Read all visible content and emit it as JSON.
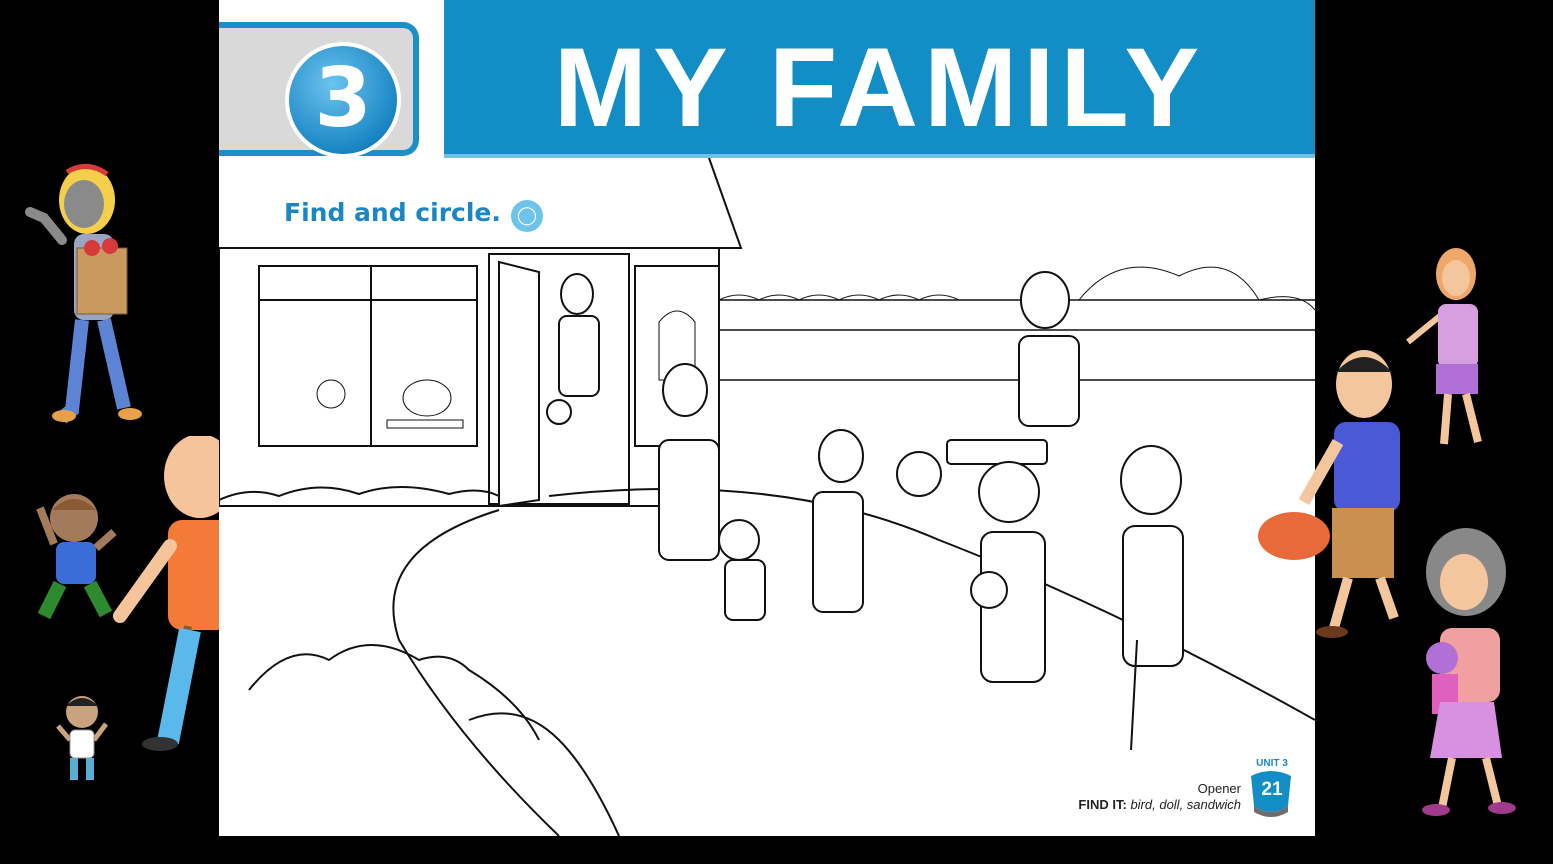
{
  "header": {
    "unit_number": "3",
    "title": "MY FAMILY"
  },
  "instruction": {
    "text": "Find and circle.",
    "icon": "speech-bubble-icon"
  },
  "footer": {
    "opener_label": "Opener",
    "find_it_label": "FIND IT:",
    "find_it_items": "bird, doll, sandwich",
    "unit_badge_label": "UNIT 3",
    "page_number": "21"
  },
  "colors": {
    "accent_blue": "#138dc5",
    "light_blue": "#6ec3ea",
    "background": "#000000",
    "page": "#ffffff"
  }
}
